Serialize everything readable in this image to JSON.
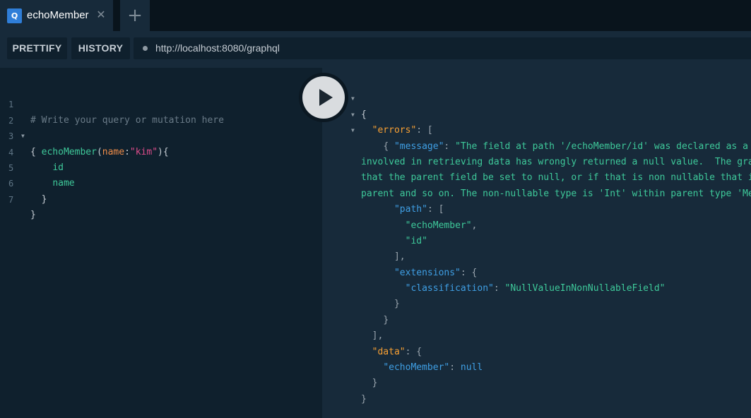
{
  "tab": {
    "badge": "Q",
    "title": "echoMember",
    "close_glyph": "✕",
    "add_glyph": "+"
  },
  "toolbar": {
    "prettify_label": "PRETTIFY",
    "history_label": "HISTORY",
    "url": "http://localhost:8080/graphql"
  },
  "editor": {
    "line_numbers": [
      "1",
      "2",
      "3",
      "4",
      "5",
      "6",
      "7"
    ],
    "comment": "# Write your query or mutation here",
    "open_brace": "{",
    "field": "echoMember",
    "paren_open": "(",
    "arg_name": "name",
    "colon": ":",
    "arg_value": "\"kim\"",
    "paren_close_brace": "){",
    "sub_field_1": "id",
    "sub_field_2": "name",
    "inner_close": "}",
    "outer_close": "}"
  },
  "result": {
    "open_brace": "{",
    "errors_key": "\"errors\"",
    "message_key": "\"message\"",
    "message_lines": [
      "\"The field at path '/echoMember/id' was declared as a non null type, but the code",
      "involved in retrieving data has wrongly returned a null value.  The graphql specification requires",
      "that the parent field be set to null, or if that is non nullable that it bubble up null to its",
      "parent and so on. The non-nullable type is 'Int' within parent type 'Member'\","
    ],
    "path_key": "\"path\"",
    "path_values": [
      "\"echoMember\"",
      "\"id\""
    ],
    "extensions_key": "\"extensions\"",
    "classification_key": "\"classification\"",
    "classification_value": "\"NullValueInNonNullableField\"",
    "data_key": "\"data\"",
    "echo_member_key": "\"echoMember\"",
    "null_value": "null"
  },
  "icons": {
    "play": "play-icon",
    "fold": "fold-arrow-icon"
  }
}
